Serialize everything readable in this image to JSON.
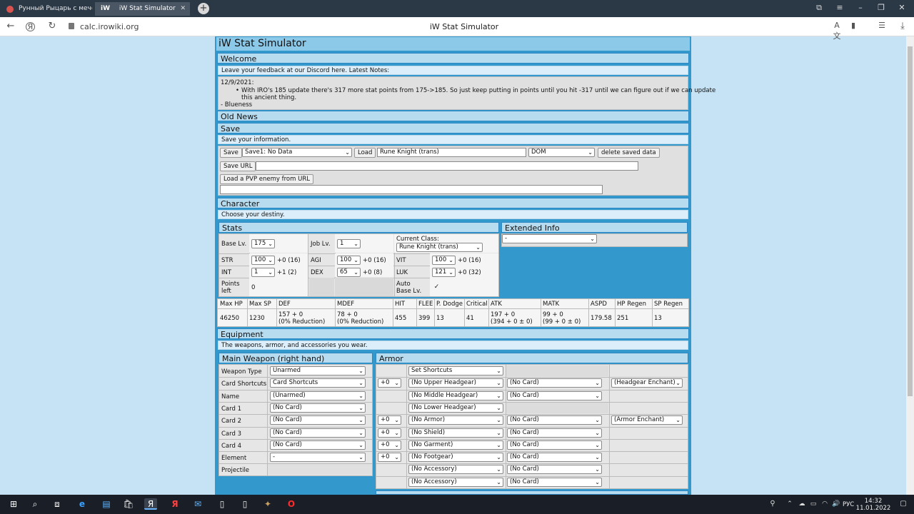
{
  "browser": {
    "tab1_title": "Рунный Рыцарь с мечом",
    "tab2_badge": "iW",
    "tab2_title": "iW Stat Simulator",
    "url": "calc.irowiki.org",
    "page_title": "iW Stat Simulator"
  },
  "page": {
    "title": "iW Stat Simulator",
    "welcome": {
      "header": "Welcome",
      "feedback": "Leave your feedback at our Discord here. Latest Notes:",
      "date": "12/9/2021:",
      "bullet": "With IRO's 185 update there's 317 more stat points from 175->185. So just keep putting in points until you hit -317 until we can figure out if we can update",
      "bullet_cont": "this ancient thing.",
      "signature": "- Blueness"
    },
    "old_news": "Old News",
    "save": {
      "header": "Save",
      "note": "Save your information.",
      "save_button": "Save",
      "slot": "Save1: No Data",
      "load_button": "Load",
      "name_value": "Rune Knight (trans)",
      "server": "DOM",
      "delete_button": "delete saved data",
      "save_url_button": "Save URL",
      "pvp_button": "Load a PVP enemy from URL"
    },
    "character": {
      "header": "Character",
      "note": "Choose your destiny."
    },
    "stats": {
      "header": "Stats",
      "base_lv_label": "Base Lv.",
      "base_lv": "175",
      "job_lv_label": "Job Lv.",
      "job_lv": "1",
      "current_class_label": "Current Class:",
      "current_class": "Rune Knight (trans)",
      "str_label": "STR",
      "str": "100",
      "str_bonus": "+0 (16)",
      "agi_label": "AGI",
      "agi": "100",
      "agi_bonus": "+0 (16)",
      "vit_label": "VIT",
      "vit": "100",
      "vit_bonus": "+0 (16)",
      "int_label": "INT",
      "int": "1",
      "int_bonus": "+1 (2)",
      "dex_label": "DEX",
      "dex": "65",
      "dex_bonus": "+0 (8)",
      "luk_label": "LUK",
      "luk": "121",
      "luk_bonus": "+0 (32)",
      "points_left_label_1": "Points",
      "points_left_label_2": "left",
      "points_left": "0",
      "auto_base_label_1": "Auto",
      "auto_base_label_2": "Base Lv.",
      "auto_base_checked": "✓"
    },
    "extended": {
      "header": "Extended Info",
      "value": "-"
    },
    "substats": {
      "headers": [
        "Max HP",
        "Max SP",
        "DEF",
        "MDEF",
        "HIT",
        "FLEE",
        "P. Dodge",
        "Critical",
        "ATK",
        "MATK",
        "ASPD",
        "HP Regen",
        "SP Regen"
      ],
      "values_line1": [
        "46250",
        "1230",
        "157 + 0",
        "78 + 0",
        "455",
        "399",
        "13",
        "41",
        "197 + 0",
        "99 + 0",
        "179.58",
        "251",
        "13"
      ],
      "values_line2": [
        "",
        "",
        "(0% Reduction)",
        "(0% Reduction)",
        "",
        "",
        "",
        "",
        "(394 + 0 ± 0)",
        "(99 + 0 ± 0)",
        "",
        "",
        ""
      ]
    },
    "equipment": {
      "header": "Equipment",
      "note": "The weapons, armor, and accessories you wear.",
      "weapon": {
        "header": "Main Weapon (right hand)",
        "rows": [
          {
            "label": "Weapon Type",
            "value": "Unarmed"
          },
          {
            "label": "Card Shortcuts",
            "value": "Card Shortcuts"
          },
          {
            "label": "Name",
            "value": "(Unarmed)"
          },
          {
            "label": "Card 1",
            "value": "(No Card)"
          },
          {
            "label": "Card 2",
            "value": "(No Card)"
          },
          {
            "label": "Card 3",
            "value": "(No Card)"
          },
          {
            "label": "Card 4",
            "value": "(No Card)"
          },
          {
            "label": "Element",
            "value": "-"
          },
          {
            "label": "Projectile",
            "value": ""
          }
        ]
      },
      "armor": {
        "header": "Armor",
        "set_shortcuts": "Set Shortcuts",
        "rows": [
          {
            "refine": "+0",
            "item": "(No Upper Headgear)",
            "card": "(No Card)",
            "enchant": "(Headgear Enchant)"
          },
          {
            "refine": "",
            "item": "(No Middle Headgear)",
            "card": "(No Card)",
            "enchant": ""
          },
          {
            "refine": "",
            "item": "(No Lower Headgear)",
            "card": "",
            "enchant": ""
          },
          {
            "refine": "+0",
            "item": "(No Armor)",
            "card": "(No Card)",
            "enchant": "(Armor Enchant)"
          },
          {
            "refine": "+0",
            "item": "(No Shield)",
            "card": "(No Card)",
            "enchant": ""
          },
          {
            "refine": "+0",
            "item": "(No Garment)",
            "card": "(No Card)",
            "enchant": ""
          },
          {
            "refine": "+0",
            "item": "(No Footgear)",
            "card": "(No Card)",
            "enchant": ""
          },
          {
            "refine": "",
            "item": "(No Accessory)",
            "card": "(No Card)",
            "enchant": ""
          },
          {
            "refine": "",
            "item": "(No Accessory)",
            "card": "(No Card)",
            "enchant": ""
          }
        ]
      }
    }
  },
  "taskbar": {
    "lang": "РУС",
    "time": "14:32",
    "date": "11.01.2022"
  }
}
